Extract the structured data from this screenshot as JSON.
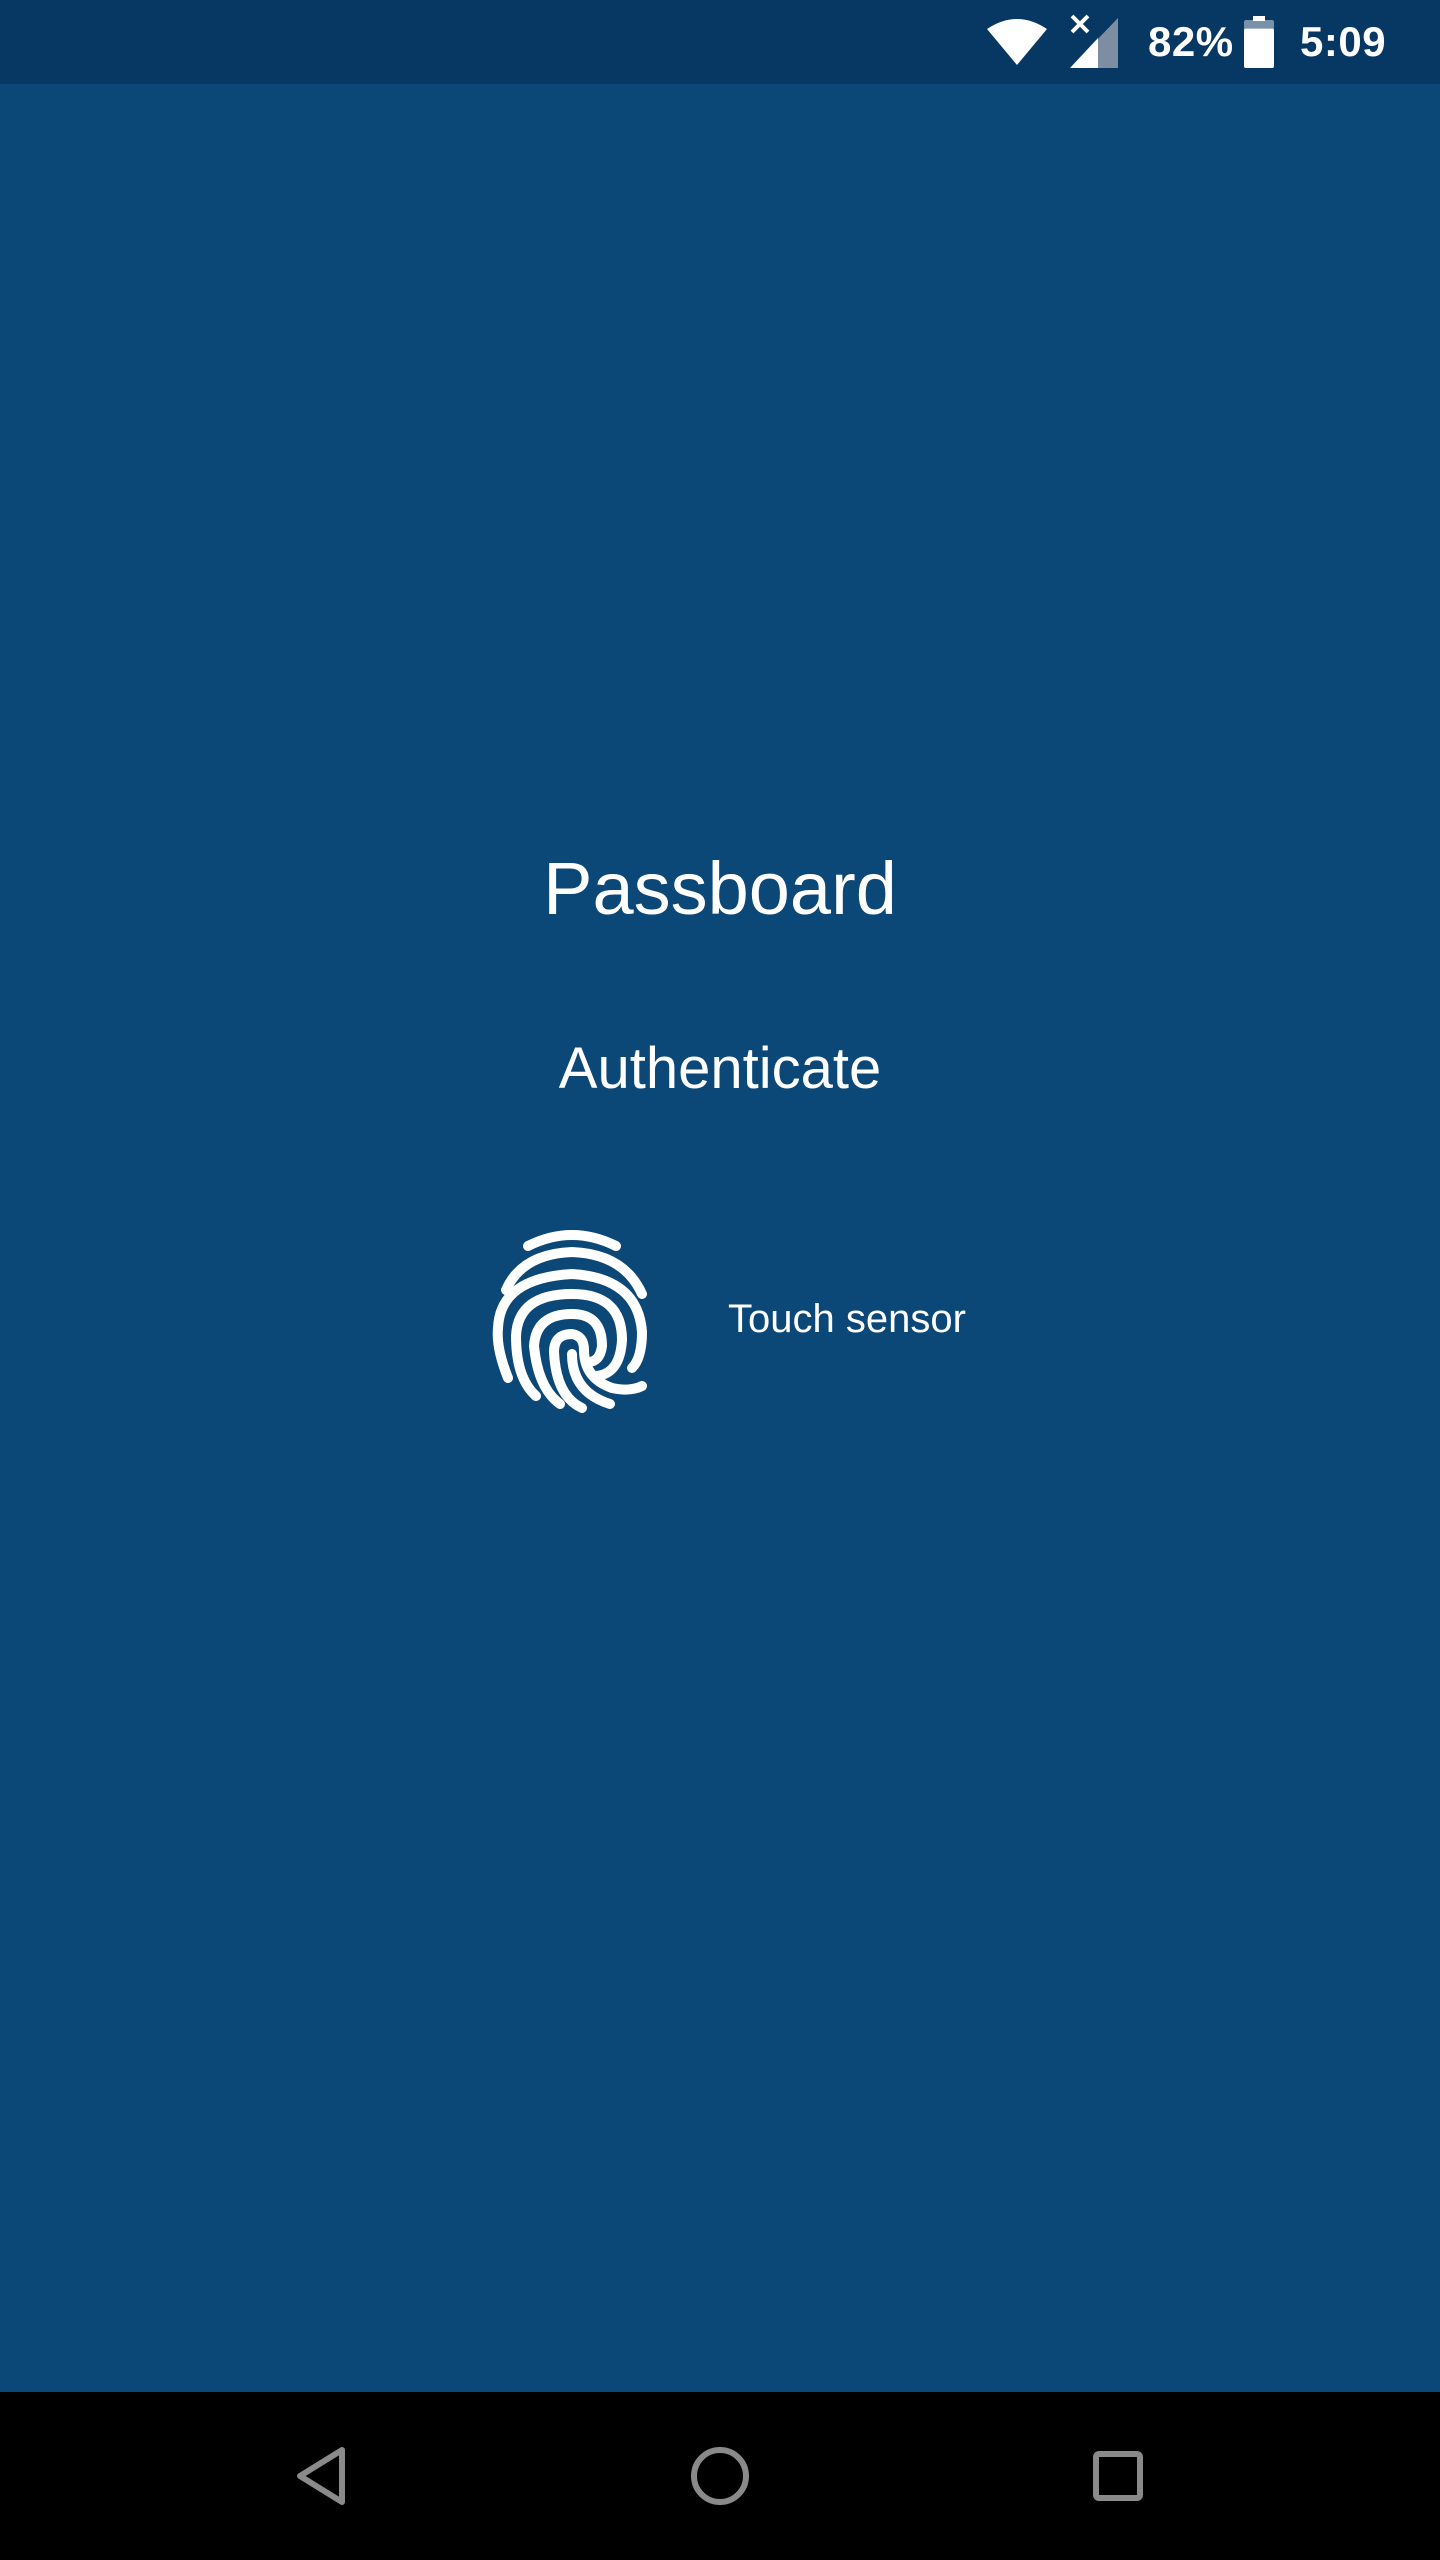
{
  "status_bar": {
    "battery_percent": "82%",
    "time": "5:09",
    "battery_level": 0.82,
    "icons": [
      "wifi-icon",
      "signal-no-data-icon",
      "battery-icon"
    ]
  },
  "main": {
    "app_title": "Passboard",
    "subtitle": "Authenticate",
    "sensor_label": "Touch sensor",
    "sensor_icon": "fingerprint-icon"
  },
  "nav_bar": {
    "icons": [
      "back-icon",
      "home-icon",
      "recents-icon"
    ]
  },
  "colors": {
    "background": "#0b4777",
    "status_bar": "#073863",
    "nav_bar": "#000000",
    "text": "#ffffff",
    "nav_icon": "#8a8a8a"
  }
}
